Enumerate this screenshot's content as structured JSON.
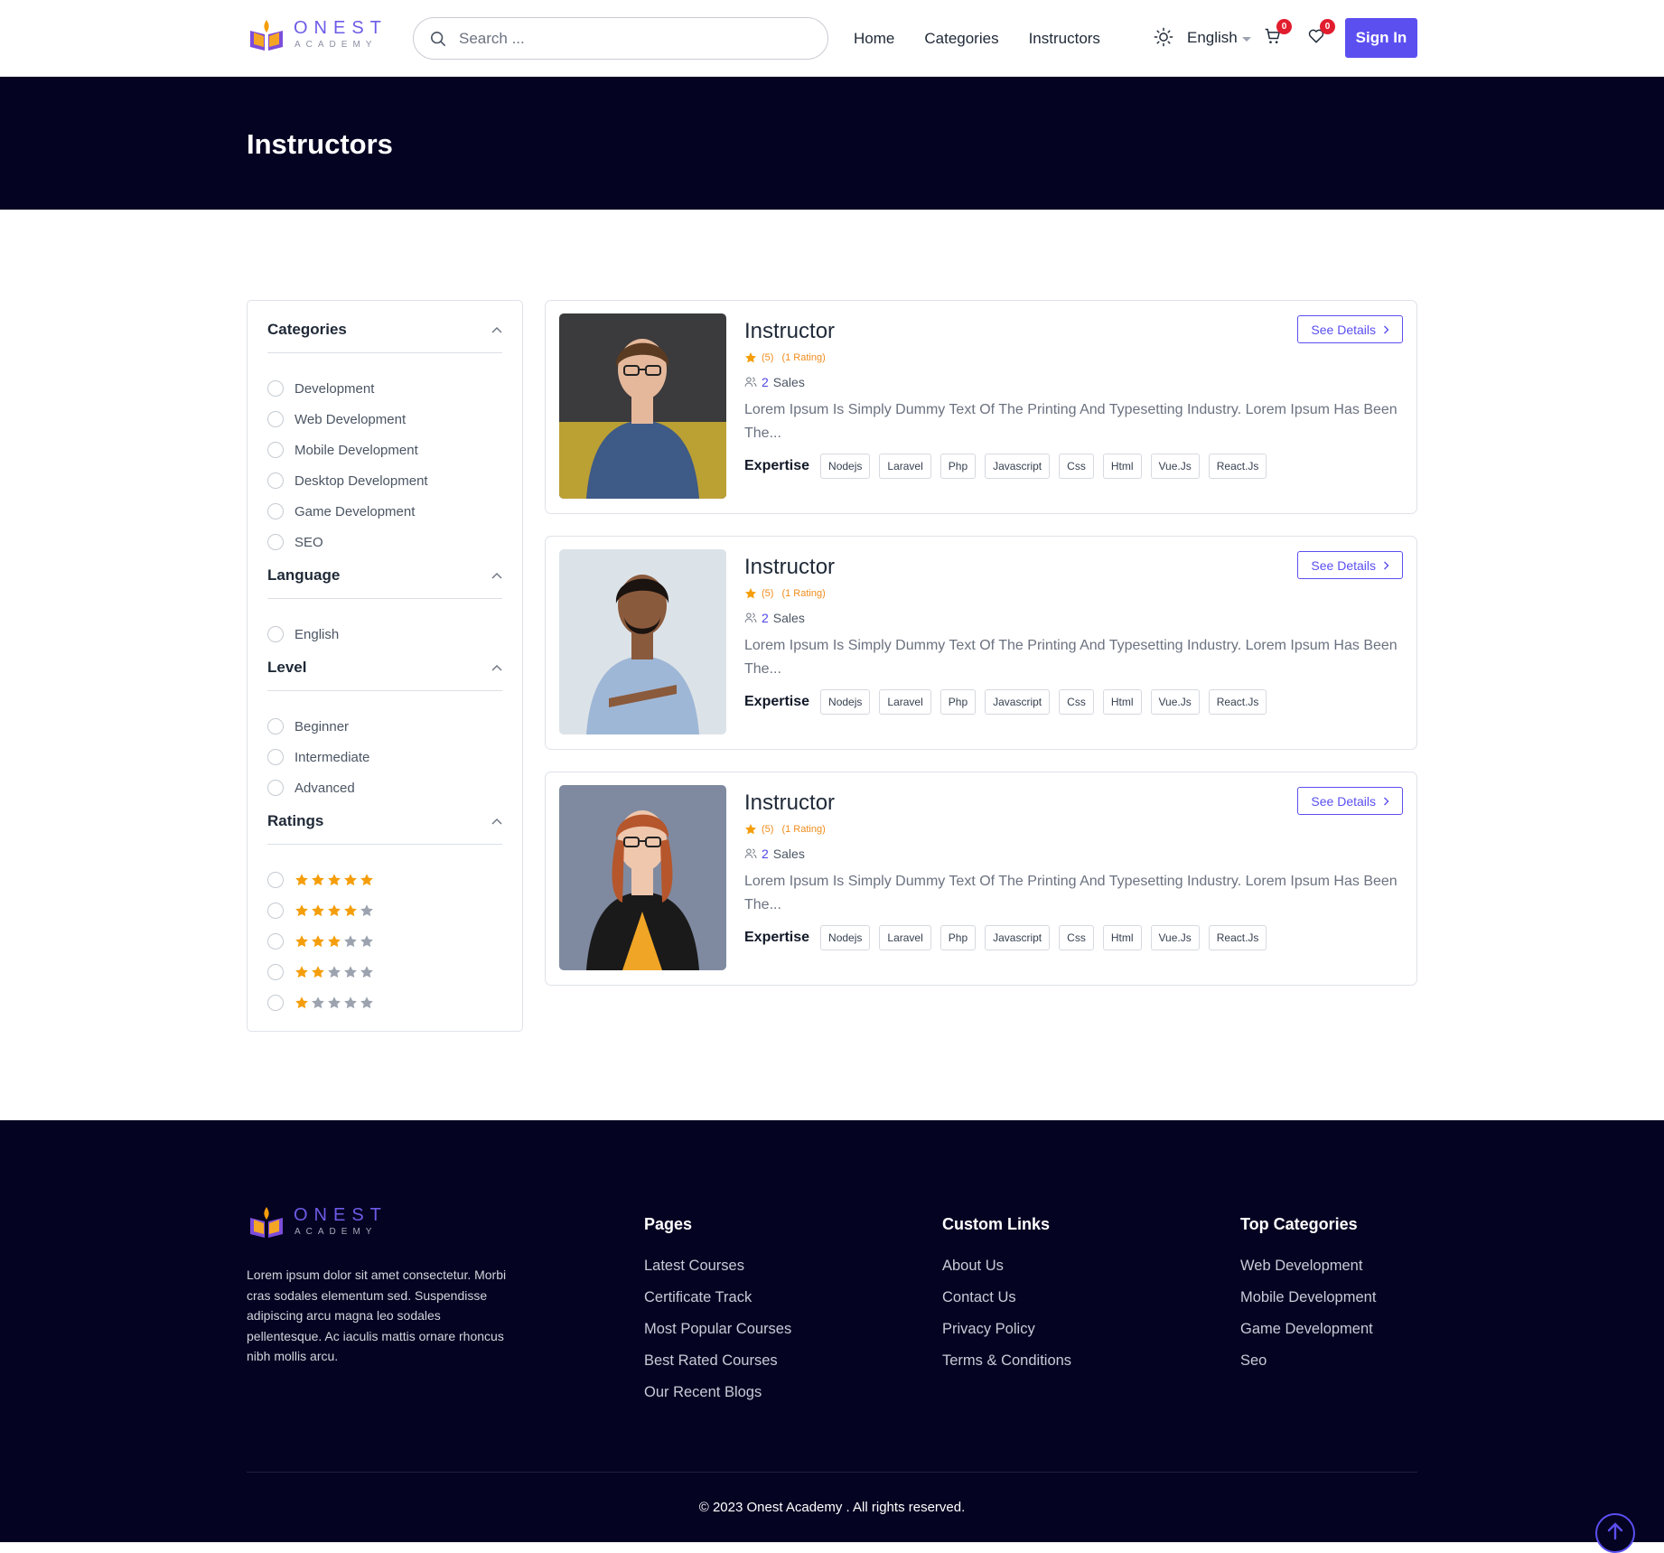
{
  "brand": {
    "name": "ONEST",
    "sub": "ACADEMY"
  },
  "header": {
    "search_placeholder": "Search ...",
    "nav": [
      "Home",
      "Categories",
      "Instructors"
    ],
    "language": "English",
    "cart_count": "0",
    "wishlist_count": "0",
    "signin_label": "Sign In"
  },
  "banner": {
    "title": "Instructors"
  },
  "filters": {
    "categories": {
      "title": "Categories",
      "options": [
        "Development",
        "Web Development",
        "Mobile Development",
        "Desktop Development",
        "Game Development",
        "SEO"
      ]
    },
    "language": {
      "title": "Language",
      "options": [
        "English"
      ]
    },
    "level": {
      "title": "Level",
      "options": [
        "Beginner",
        "Intermediate",
        "Advanced"
      ]
    },
    "ratings": {
      "title": "Ratings",
      "options": [
        5,
        4,
        3,
        2,
        1
      ]
    }
  },
  "instructors": [
    {
      "name": "Instructor",
      "score": "(5)",
      "rating_count": "(1 Rating)",
      "sales_num": "2",
      "sales_label": "Sales",
      "description": "Lorem Ipsum Is Simply Dummy Text Of The Printing And Typesetting Industry. Lorem Ipsum Has Been The...",
      "expertise_label": "Expertise",
      "tags": [
        "Nodejs",
        "Laravel",
        "Php",
        "Javascript",
        "Css",
        "Html",
        "Vue.Js",
        "React.Js"
      ],
      "details_label": "See Details"
    },
    {
      "name": "Instructor",
      "score": "(5)",
      "rating_count": "(1 Rating)",
      "sales_num": "2",
      "sales_label": "Sales",
      "description": "Lorem Ipsum Is Simply Dummy Text Of The Printing And Typesetting Industry. Lorem Ipsum Has Been The...",
      "expertise_label": "Expertise",
      "tags": [
        "Nodejs",
        "Laravel",
        "Php",
        "Javascript",
        "Css",
        "Html",
        "Vue.Js",
        "React.Js"
      ],
      "details_label": "See Details"
    },
    {
      "name": "Instructor",
      "score": "(5)",
      "rating_count": "(1 Rating)",
      "sales_num": "2",
      "sales_label": "Sales",
      "description": "Lorem Ipsum Is Simply Dummy Text Of The Printing And Typesetting Industry. Lorem Ipsum Has Been The...",
      "expertise_label": "Expertise",
      "tags": [
        "Nodejs",
        "Laravel",
        "Php",
        "Javascript",
        "Css",
        "Html",
        "Vue.Js",
        "React.Js"
      ],
      "details_label": "See Details"
    }
  ],
  "footer": {
    "about": "Lorem ipsum dolor sit amet consectetur. Morbi cras sodales elementum sed. Suspendisse adipiscing arcu magna leo sodales pellentesque. Ac iaculis mattis ornare rhoncus nibh mollis arcu.",
    "pages": {
      "title": "Pages",
      "links": [
        "Latest Courses",
        "Certificate Track",
        "Most Popular Courses",
        "Best Rated Courses",
        "Our Recent Blogs"
      ]
    },
    "custom": {
      "title": "Custom Links",
      "links": [
        "About Us",
        "Contact Us",
        "Privacy Policy",
        "Terms & Conditions"
      ]
    },
    "top": {
      "title": "Top Categories",
      "links": [
        "Web Development",
        "Mobile Development",
        "Game Development",
        "Seo"
      ]
    },
    "copyright": "© 2023 Onest Academy . All rights reserved."
  },
  "colors": {
    "accent": "#5b4ff0",
    "dark": "#050322",
    "star": "#f59e0b",
    "badge": "#e11d2e"
  }
}
